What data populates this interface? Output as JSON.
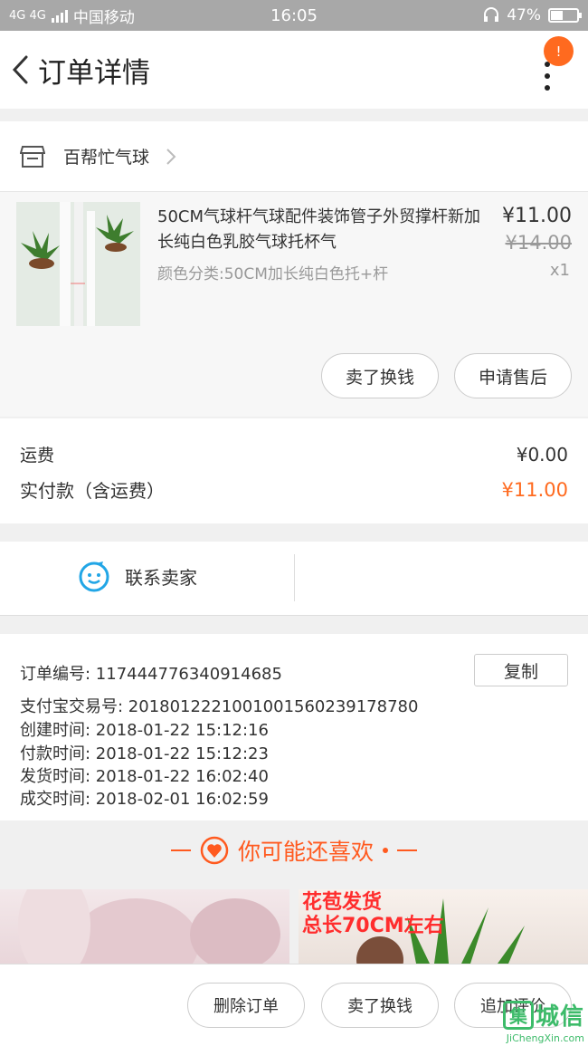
{
  "status_bar": {
    "network": "4G 4G",
    "carrier": "中国移动",
    "time": "16:05",
    "battery": "47%",
    "battery_level": 0.47
  },
  "nav": {
    "title": "订单详情",
    "badge": "!"
  },
  "shop": {
    "name": "百帮忙气球"
  },
  "product": {
    "title": "50CM气球杆气球配件装饰管子外贸撑杆新加长纯白色乳胶气球托杯气",
    "spec": "颜色分类:50CM加长纯白色托+杆",
    "price": "¥11.00",
    "original_price": "¥14.00",
    "quantity": "x1",
    "btn_repurchase": "卖了换钱",
    "btn_aftersale": "申请售后"
  },
  "fees": {
    "shipping_label": "运费",
    "shipping_value": "¥0.00",
    "paid_label": "实付款（含运费）",
    "paid_value": "¥11.00"
  },
  "contact": {
    "label": "联系卖家"
  },
  "order_info": {
    "order_no": "订单编号:  117444776340914685",
    "copy_label": "复制",
    "alipay_no": "支付宝交易号:  2018012221001001560239178780",
    "created": "创建时间:  2018-01-22 15:12:16",
    "paid": "付款时间:  2018-01-22 15:12:23",
    "shipped": "发货时间:  2018-01-22 16:02:40",
    "completed": "成交时间:  2018-02-01 16:02:59"
  },
  "recommend": {
    "heading": "你可能还喜欢"
  },
  "tiles": {
    "tile2_line1": "花苞发货",
    "tile2_line2": "总长70CM左右"
  },
  "bottom_bar": {
    "delete": "删除订单",
    "repurchase": "卖了换钱",
    "review": "追加评价"
  },
  "watermark": {
    "mark": "集",
    "text": "城信",
    "domain": "JiChengXin.com"
  },
  "colors": {
    "accent": "#ff6a1f",
    "watermark": "#3dbb6a",
    "contact_icon": "#22a6e6"
  }
}
